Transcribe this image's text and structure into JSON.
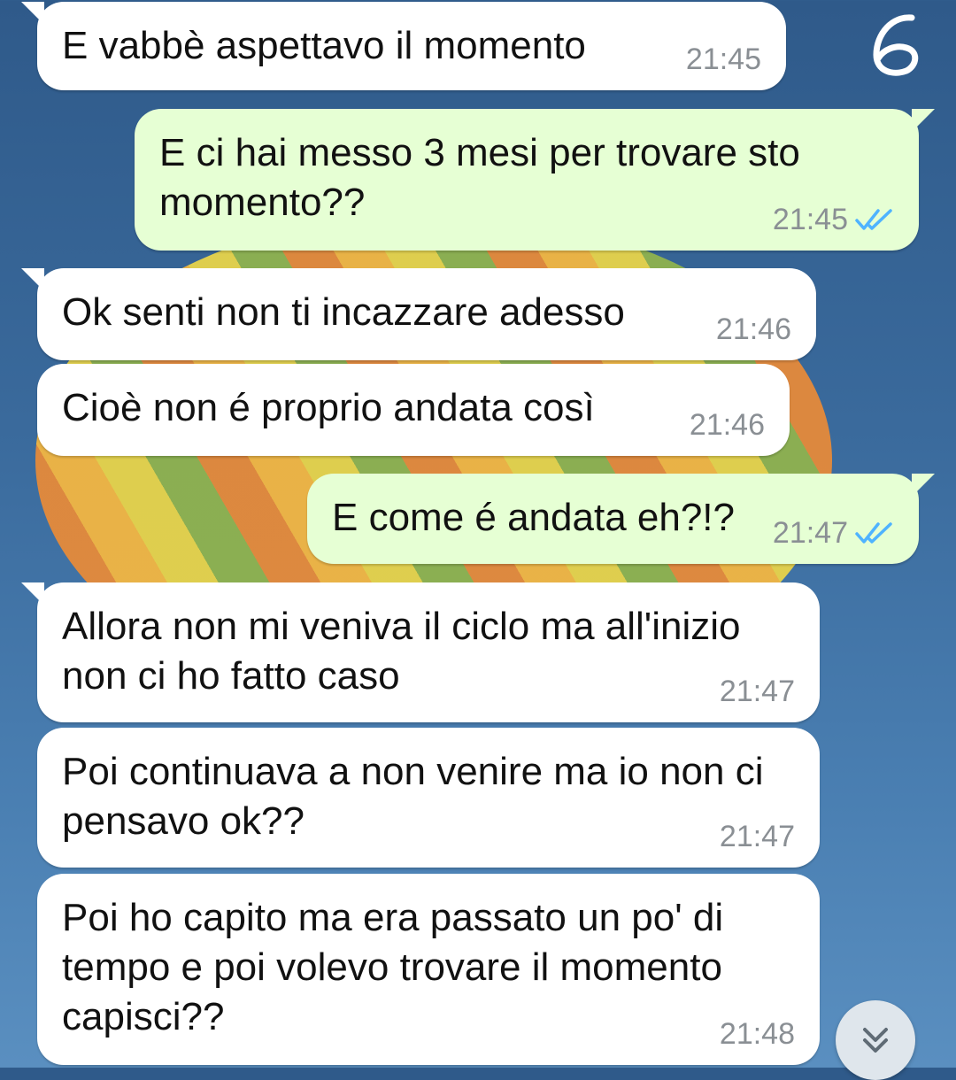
{
  "messages": [
    {
      "direction": "in",
      "text": "E vabbè aspettavo il momento",
      "time": "21:45"
    },
    {
      "direction": "out",
      "text": "E ci hai messo 3 mesi per trovare sto momento??",
      "time": "21:45",
      "status": "read"
    },
    {
      "direction": "in",
      "text": "Ok senti non ti incazzare adesso",
      "time": "21:46"
    },
    {
      "direction": "in",
      "text": "Cioè non é proprio andata così",
      "time": "21:46"
    },
    {
      "direction": "out",
      "text": "E come é andata eh?!?",
      "time": "21:47",
      "status": "read"
    },
    {
      "direction": "in",
      "text": "Allora non mi veniva il ciclo ma all'inizio non ci ho fatto caso",
      "time": "21:47"
    },
    {
      "direction": "in",
      "text": "Poi continuava a non venire ma io non ci pensavo ok??",
      "time": "21:47"
    },
    {
      "direction": "in",
      "text": "Poi ho capito ma era passato un po' di tempo e poi volevo trovare il momento capisci??",
      "time": "21:48"
    }
  ],
  "overlay": {
    "page_number": "6"
  },
  "icons": {
    "read_ticks": "double-check-icon",
    "scroll_down": "double-chevron-down-icon"
  },
  "colors": {
    "incoming_bubble": "#ffffff",
    "outgoing_bubble": "#e6ffd4",
    "read_tick": "#4fb3ff",
    "timestamp": "#8a8f94"
  }
}
